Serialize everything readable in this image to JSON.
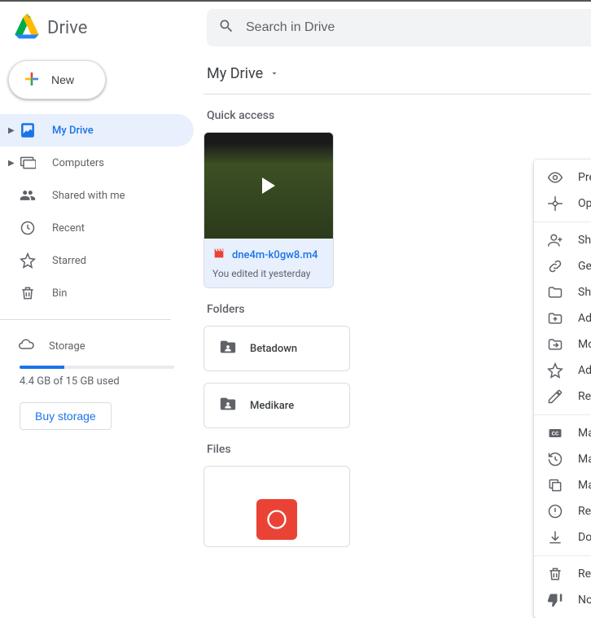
{
  "app_name": "Drive",
  "search": {
    "placeholder": "Search in Drive"
  },
  "new_button": "New",
  "sidebar": {
    "items": [
      {
        "label": "My Drive",
        "selected": true,
        "expandable": true
      },
      {
        "label": "Computers",
        "selected": false,
        "expandable": true
      },
      {
        "label": "Shared with me",
        "selected": false
      },
      {
        "label": "Recent",
        "selected": false
      },
      {
        "label": "Starred",
        "selected": false
      },
      {
        "label": "Bin",
        "selected": false
      }
    ],
    "storage": {
      "label": "Storage",
      "used_text": "4.4 GB of 15 GB used",
      "percent": 29,
      "buy_label": "Buy storage"
    }
  },
  "main": {
    "location": "My Drive",
    "sections": {
      "quick_title": "Quick access",
      "quick_item": {
        "name": "dne4m-k0gw8.m4",
        "subtitle": "You edited it yesterday"
      },
      "folders_title": "Folders",
      "folders": [
        "Betadown",
        "Medikare"
      ],
      "files_title": "Files"
    }
  },
  "context_menu": {
    "groups": [
      [
        {
          "icon": "eye",
          "label": "Preview"
        },
        {
          "icon": "openwith",
          "label": "Open with",
          "submenu": true
        }
      ],
      [
        {
          "icon": "personadd",
          "label": "Share"
        },
        {
          "icon": "link",
          "label": "Get link"
        },
        {
          "icon": "folder",
          "label": "Show file location"
        },
        {
          "icon": "shortcut",
          "label": "Add a shortcut to Drive",
          "help": true
        },
        {
          "icon": "moveto",
          "label": "Move to"
        },
        {
          "icon": "star",
          "label": "Add to Starred"
        },
        {
          "icon": "rename",
          "label": "Rename"
        }
      ],
      [
        {
          "icon": "cc",
          "label": "Manage caption tracks"
        },
        {
          "icon": "versions",
          "label": "Manage versions"
        },
        {
          "icon": "copy",
          "label": "Make a copy"
        },
        {
          "icon": "report",
          "label": "Report abuse"
        },
        {
          "icon": "download",
          "label": "Download"
        }
      ],
      [
        {
          "icon": "trash",
          "label": "Remove"
        },
        {
          "icon": "thumbdown",
          "label": "Not a helpful suggestion"
        }
      ]
    ]
  }
}
